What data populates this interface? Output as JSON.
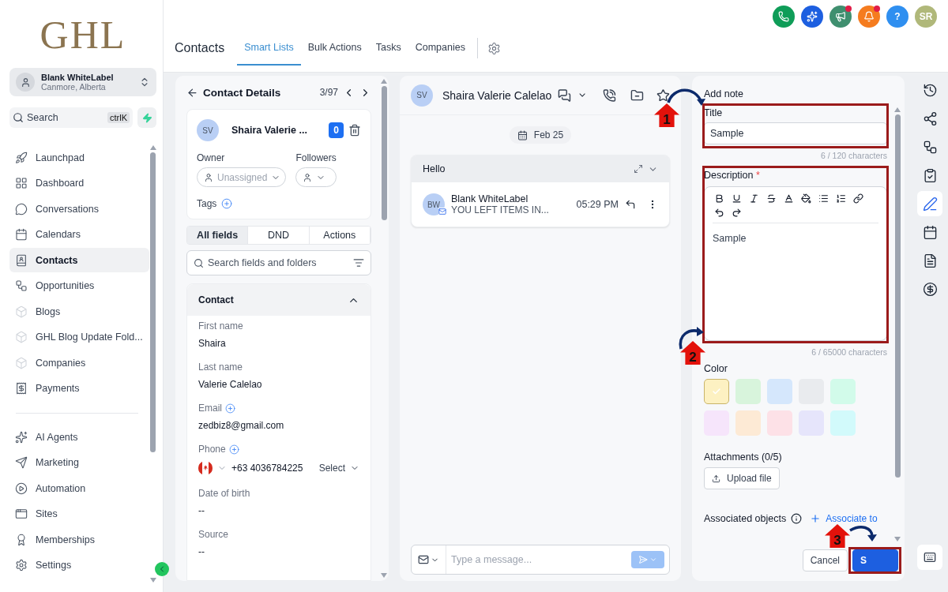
{
  "logo": "GHL",
  "account": {
    "name": "Blank WhiteLabel",
    "location": "Canmore, Alberta"
  },
  "search": {
    "placeholder": "Search",
    "shortcut": "ctrlK"
  },
  "nav_primary": [
    {
      "label": "Launchpad",
      "kind": "launchpad",
      "selected": false
    },
    {
      "label": "Dashboard",
      "kind": "dashboard",
      "selected": false
    },
    {
      "label": "Conversations",
      "kind": "conversations",
      "selected": false
    },
    {
      "label": "Calendars",
      "kind": "calendars",
      "selected": false
    },
    {
      "label": "Contacts",
      "kind": "contacts",
      "selected": true
    },
    {
      "label": "Opportunities",
      "kind": "opportunities",
      "selected": false
    },
    {
      "label": "Blogs",
      "kind": "box",
      "selected": false
    },
    {
      "label": "GHL Blog Update Fold...",
      "kind": "box",
      "selected": false
    },
    {
      "label": "Companies",
      "kind": "box",
      "selected": false
    },
    {
      "label": "Payments",
      "kind": "payments",
      "selected": false
    }
  ],
  "nav_secondary": [
    {
      "label": "AI Agents",
      "kind": "ai",
      "selected": false
    },
    {
      "label": "Marketing",
      "kind": "marketing",
      "selected": false
    },
    {
      "label": "Automation",
      "kind": "automation",
      "selected": false
    },
    {
      "label": "Sites",
      "kind": "sites",
      "selected": false
    },
    {
      "label": "Memberships",
      "kind": "memberships",
      "selected": false
    },
    {
      "label": "Settings",
      "kind": "settings",
      "selected": false
    }
  ],
  "top_icons": [
    {
      "kind": "phone",
      "color": "#0f9d58",
      "dot": false
    },
    {
      "kind": "sparkle",
      "color": "#1d5fe0",
      "dot": false
    },
    {
      "kind": "megaphone",
      "color": "#3f8f6f",
      "dot": true
    },
    {
      "kind": "bell",
      "color": "#f57c1f",
      "dot": true
    },
    {
      "kind": "help",
      "color": "#2f8ff0",
      "dot": false,
      "glyph": "?"
    },
    {
      "kind": "avatar",
      "color": "#b0b87a",
      "dot": false,
      "glyph": "SR"
    }
  ],
  "header": {
    "title": "Contacts",
    "tabs": [
      {
        "label": "Smart Lists",
        "selected": true
      },
      {
        "label": "Bulk Actions",
        "selected": false
      },
      {
        "label": "Tasks",
        "selected": false
      },
      {
        "label": "Companies",
        "selected": false
      }
    ]
  },
  "contact_details": {
    "title": "Contact Details",
    "counter": "3/97",
    "avatar": "SV",
    "name": "Shaira Valerie ...",
    "count": "0",
    "owner_label": "Owner",
    "owner_value": "Unassigned",
    "followers_label": "Followers",
    "tags_label": "Tags",
    "tabs": [
      {
        "label": "All fields",
        "selected": true
      },
      {
        "label": "DND",
        "selected": false
      },
      {
        "label": "Actions",
        "selected": false
      }
    ],
    "search_placeholder": "Search fields and folders",
    "section": {
      "title": "Contact",
      "expanded": true,
      "fields": [
        {
          "kind": "text",
          "label": "First name",
          "value": "Shaira",
          "add_button": false
        },
        {
          "kind": "text",
          "label": "Last name",
          "value": "Valerie Calelao",
          "add_button": false
        },
        {
          "kind": "text",
          "label": "Email",
          "value": "zedbiz8@gmail.com",
          "add_button": true
        },
        {
          "kind": "phone",
          "label": "Phone",
          "value": "+63 4036784225",
          "type_select": "Select",
          "add_button": true
        },
        {
          "kind": "text",
          "label": "Date of birth",
          "value": "--",
          "add_button": false
        },
        {
          "kind": "text",
          "label": "Source",
          "value": "--",
          "add_button": false
        }
      ]
    }
  },
  "conversation": {
    "avatar": "SV",
    "name": "Shaira Valerie Calelao",
    "date": "Feb 25",
    "thread": {
      "subject": "Hello",
      "message": {
        "avatar": "BW",
        "sender": "Blank WhiteLabel",
        "preview": "YOU LEFT ITEMS IN...",
        "time": "05:29 PM"
      }
    },
    "composer_placeholder": "Type a message..."
  },
  "note": {
    "heading": "Add note",
    "title_label": "Title",
    "title_value": "Sample",
    "title_count": "6 / 120 characters",
    "description_label": "Description",
    "required_mark": "*",
    "description_value": "Sample",
    "description_count": "6 / 65000 characters",
    "color_label": "Color",
    "colors": [
      {
        "color": "#fdf1c2",
        "selected": true
      },
      {
        "color": "#d8f4dc",
        "selected": false
      },
      {
        "color": "#d5e7fc",
        "selected": false
      },
      {
        "color": "#e9ebee",
        "selected": false
      },
      {
        "color": "#d2fbea",
        "selected": false
      },
      {
        "color": "#f6e5fb",
        "selected": false
      },
      {
        "color": "#fdead5",
        "selected": false
      },
      {
        "color": "#fde1e7",
        "selected": false
      },
      {
        "color": "#e6e5fb",
        "selected": false
      },
      {
        "color": "#d2fafb",
        "selected": false
      }
    ],
    "attachments_label": "Attachments (0/5)",
    "upload_label": "Upload file",
    "associated_label": "Associated objects",
    "associate_link": "Associate to",
    "cancel_label": "Cancel",
    "save_label": "S"
  },
  "rail": [
    {
      "kind": "history",
      "selected": false
    },
    {
      "kind": "share",
      "selected": false
    },
    {
      "kind": "workflow",
      "selected": false
    },
    {
      "kind": "clipboard",
      "selected": false
    },
    {
      "kind": "pen",
      "selected": true
    },
    {
      "kind": "calendar",
      "selected": false
    },
    {
      "kind": "file",
      "selected": false
    },
    {
      "kind": "dollar",
      "selected": false
    }
  ],
  "annotations": [
    {
      "number": "1"
    },
    {
      "number": "2"
    },
    {
      "number": "3"
    }
  ]
}
